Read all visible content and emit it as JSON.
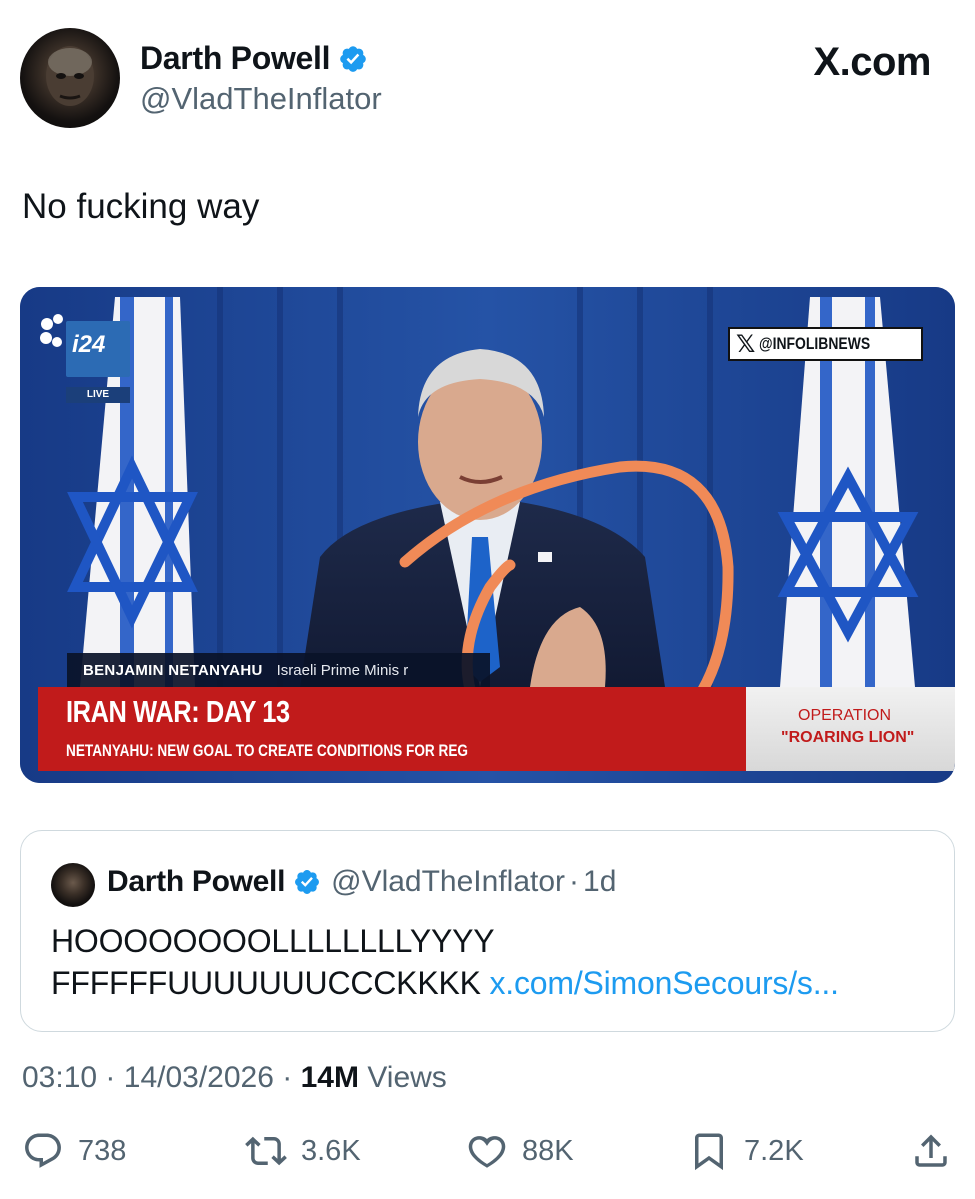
{
  "author": {
    "display_name": "Darth Powell",
    "handle": "@VladTheInflator",
    "verified": true,
    "avatar_icon": "avatar-icon"
  },
  "site": {
    "label": "X.com"
  },
  "tweet": {
    "text": "No fucking way"
  },
  "media": {
    "watermark_label": "@INFOLIBNEWS",
    "channel_logo": "i24",
    "live_label": "LIVE",
    "name_label": "BENJAMIN NETANYAHU",
    "title_label": "Israeli Prime Minis   r",
    "headline": "IRAN WAR: DAY 13",
    "subline": "NETANYAHU: NEW GOAL TO CREATE CONDITIONS FOR REG",
    "operation_line1": "OPERATION",
    "operation_line2": "\"ROARING LION\"",
    "colors": {
      "banner_red": "#c11b1b",
      "annotation": "#f08a57",
      "flag_blue": "#1f56c4"
    }
  },
  "quote": {
    "display_name": "Darth Powell",
    "handle": "@VladTheInflator",
    "separator": "·",
    "time": "1d",
    "line1": "HOOOOOOOOLLLLLLLLYYYY",
    "line2_text": "FFFFFFUUUUUUUCCCKKKK",
    "link": "x.com/SimonSecours/s..."
  },
  "meta": {
    "time": "03:10",
    "date": "14/03/2026",
    "separator": "·",
    "views_count": "14M",
    "views_label": "Views"
  },
  "actions": {
    "replies": "738",
    "reposts": "3.6K",
    "likes": "88K",
    "bookmarks": "7.2K"
  },
  "accent_color": "#1d9bf0"
}
